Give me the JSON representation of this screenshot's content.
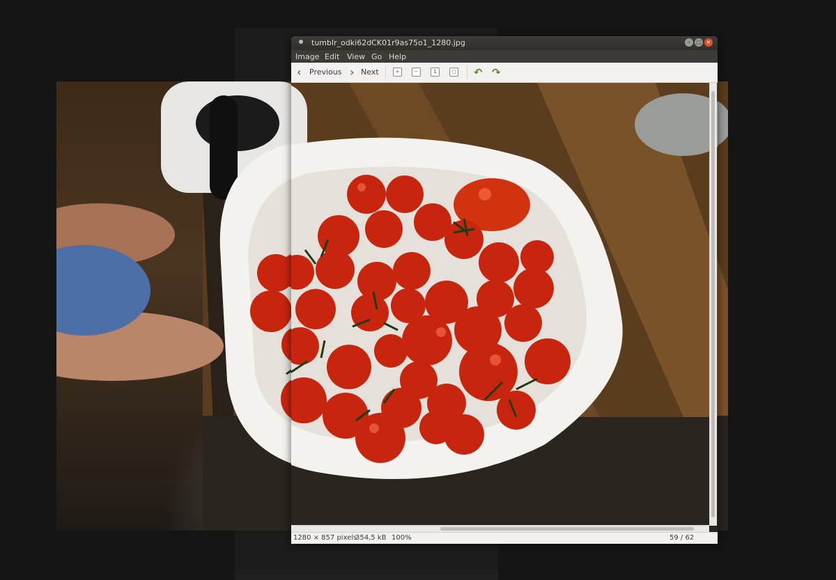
{
  "window": {
    "title": "tumblr_odki62dCK01r9as75o1_1280.jpg",
    "controls": {
      "minimize": "–",
      "maximize": "□",
      "close": "×"
    }
  },
  "menu": [
    "Image",
    "Edit",
    "View",
    "Go",
    "Help"
  ],
  "toolbar": {
    "previous_label": "Previous",
    "next_label": "Next",
    "previous_icon": "chevron-left-icon",
    "next_icon": "chevron-right-icon",
    "rotate_left_icon": "rotate-left-icon",
    "rotate_right_icon": "rotate-right-icon"
  },
  "status": {
    "dimensions": "1280 × 857 pixels",
    "size": "354,5 kB",
    "zoom": "100%",
    "position": "59 / 62"
  },
  "colors": {
    "accent_green": "#5a8a2d",
    "titlebar": "#3c3b37",
    "close_button": "#e0502a"
  }
}
